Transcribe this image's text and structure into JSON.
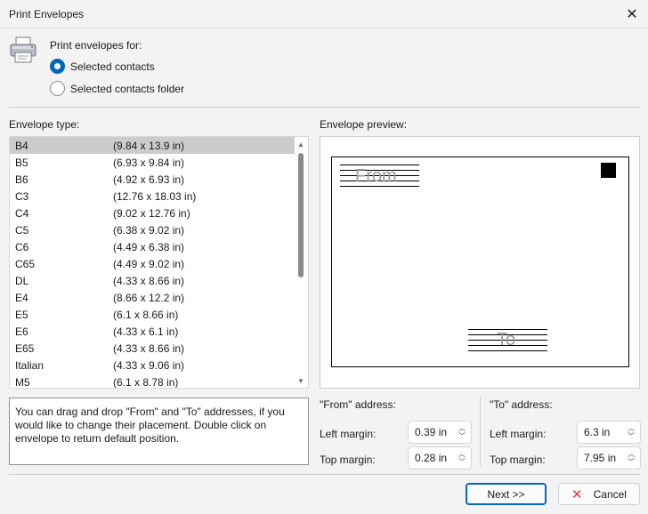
{
  "window": {
    "title": "Print Envelopes"
  },
  "print_for": {
    "label": "Print envelopes for:",
    "options": [
      {
        "label": "Selected contacts",
        "checked": true
      },
      {
        "label": "Selected contacts folder",
        "checked": false
      }
    ]
  },
  "envelope_type": {
    "label": "Envelope type:",
    "items": [
      {
        "name": "B4",
        "size": "(9.84 x 13.9 in)"
      },
      {
        "name": "B5",
        "size": "(6.93 x 9.84 in)"
      },
      {
        "name": "B6",
        "size": "(4.92 x 6.93 in)"
      },
      {
        "name": "C3",
        "size": "(12.76 x 18.03 in)"
      },
      {
        "name": "C4",
        "size": "(9.02 x 12.76 in)"
      },
      {
        "name": "C5",
        "size": "(6.38 x 9.02 in)"
      },
      {
        "name": "C6",
        "size": "(4.49 x 6.38 in)"
      },
      {
        "name": "C65",
        "size": "(4.49 x 9.02 in)"
      },
      {
        "name": "DL",
        "size": "(4.33 x 8.66 in)"
      },
      {
        "name": "E4",
        "size": "(8.66 x 12.2 in)"
      },
      {
        "name": "E5",
        "size": "(6.1 x 8.66 in)"
      },
      {
        "name": "E6",
        "size": "(4.33 x 6.1 in)"
      },
      {
        "name": "E65",
        "size": "(4.33 x 8.66 in)"
      },
      {
        "name": "Italian",
        "size": "(4.33 x 9.06 in)"
      },
      {
        "name": "M5",
        "size": "(6.1 x 8.78 in)"
      }
    ],
    "selected_index": 0
  },
  "info_text": "You can drag and drop \"From\" and \"To\" addresses, if you would like to change their placement. Double click on envelope to return default position.",
  "preview": {
    "label": "Envelope preview:",
    "from_text": "From",
    "to_text": "To"
  },
  "from_address": {
    "heading": "\"From\" address:",
    "left_margin_label": "Left margin:",
    "left_margin": "0.39 in",
    "top_margin_label": "Top margin:",
    "top_margin": "0.28 in"
  },
  "to_address": {
    "heading": "\"To\" address:",
    "left_margin_label": "Left margin:",
    "left_margin": "6.3 in",
    "top_margin_label": "Top margin:",
    "top_margin": "7.95 in"
  },
  "buttons": {
    "next": "Next >>",
    "cancel": "Cancel"
  },
  "colors": {
    "accent": "#0067c0",
    "cancel_icon": "#e03a3a",
    "selection": "#cccccc"
  }
}
